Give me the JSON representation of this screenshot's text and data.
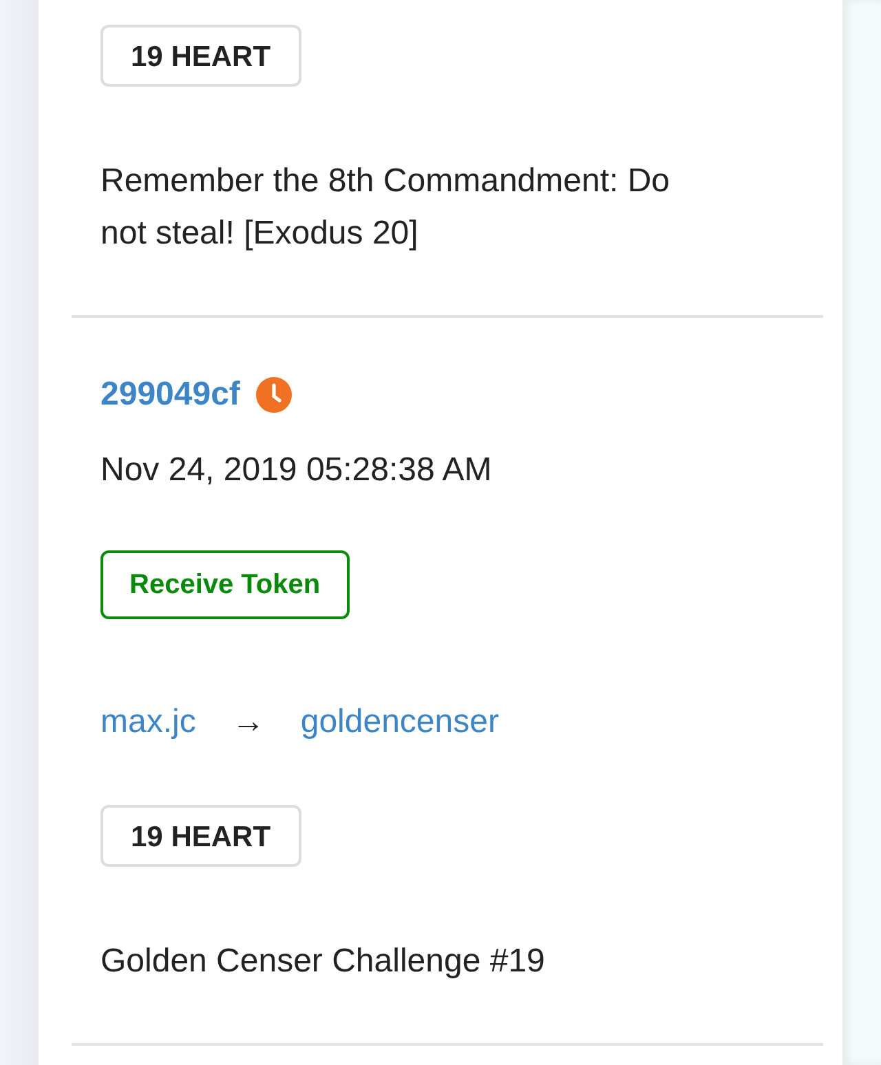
{
  "transactions": [
    {
      "amount": "19 HEART",
      "memo": "Remember the 8th Commandment: Do not steal! [Exodus 20]"
    },
    {
      "id": "299049cf",
      "pending": true,
      "date": "Nov 24, 2019 05:28:38 AM",
      "action": {
        "label": "Receive Token",
        "kind": "receive"
      },
      "from": "max.jc",
      "arrow": "→",
      "to": "goldencenser",
      "amount": "19 HEART",
      "memo": "Golden Censer Challenge #19"
    }
  ]
}
